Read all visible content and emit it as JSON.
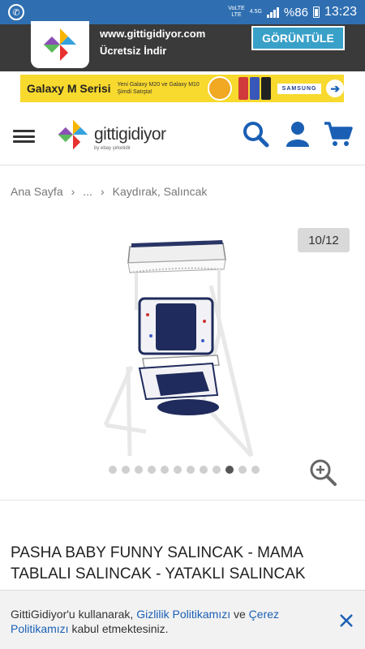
{
  "status_bar": {
    "network_top": "VoLTE",
    "lte": "LTE",
    "gen": "4.5G",
    "battery": "%86",
    "time": "13:23"
  },
  "app_banner": {
    "url": "www.gittigidiyor.com",
    "subtitle": "Ücretsiz İndir",
    "view_button": "GÖRÜNTÜLE"
  },
  "ad_banner": {
    "headline": "Galaxy M Serisi",
    "subtext": "Yeni Galaxy M20 ve Galaxy M10 Şimdi Satışta!",
    "brand": "SAMSUNG",
    "bg_color": "#f8d92d"
  },
  "header": {
    "logo_text": "gittigidiyor",
    "logo_subtext": "by ebay şirketidir",
    "icons": [
      "menu-icon",
      "search-icon",
      "user-icon",
      "cart-icon"
    ],
    "accent_color": "#1a5fb4"
  },
  "breadcrumb": {
    "items": [
      "Ana Sayfa",
      "...",
      "Kaydırak, Salıncak"
    ]
  },
  "gallery": {
    "counter": "10/12",
    "current_image": 10,
    "total_images": 12
  },
  "product": {
    "title": "PASHA BABY FUNNY SALINCAK - MAMA TABLALI SALINCAK - YATAKLI SALINCAK"
  },
  "cookie_notice": {
    "prefix": "GittiGidiyor'u kullanarak, ",
    "link1": "Gizlilik Politikamızı",
    "middle": " ve ",
    "link2": "Çerez Politikamızı",
    "suffix": " kabul etmektesiniz."
  }
}
